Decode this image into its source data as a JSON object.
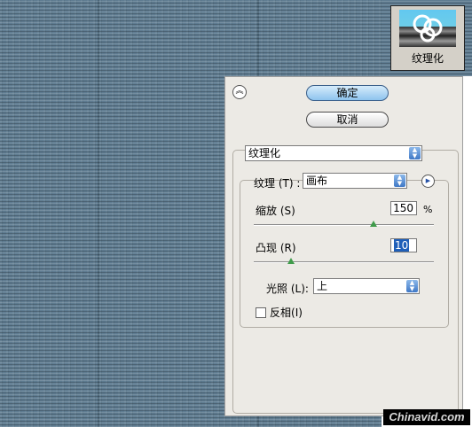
{
  "filter_thumbnail": {
    "label": "纹理化",
    "icon": "filter-thumbnail-icon"
  },
  "buttons": {
    "ok_label": "确定",
    "cancel_label": "取消"
  },
  "filter_select": {
    "value": "纹理化"
  },
  "texture": {
    "label": "纹理",
    "accel": "(T)",
    "colon": ":",
    "value": "画布"
  },
  "scaling": {
    "label": "缩放",
    "accel": "(S)",
    "value": "150",
    "unit": "%",
    "level": 0.67
  },
  "relief": {
    "label": "凸现",
    "accel": "(R)",
    "value": "10",
    "level": 0.2
  },
  "light": {
    "label": "光照",
    "accel": "(L)",
    "colon": ":",
    "value": "上"
  },
  "invert": {
    "label": "反相",
    "accel": "(I)",
    "checked": false
  },
  "watermark": "Chinavid.com",
  "colors": {
    "ok_button": "#8ec3ee",
    "preview_base": "#5f7c91",
    "slider_thumb": "#3f9b4a"
  }
}
